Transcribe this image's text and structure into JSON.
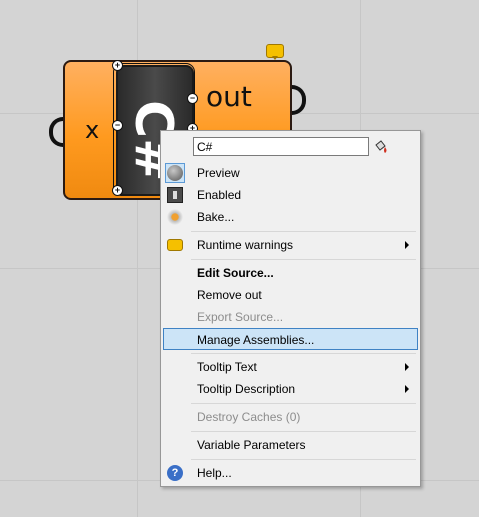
{
  "component": {
    "input_label": "x",
    "output_label": "out",
    "glyph": "C#"
  },
  "menu": {
    "name_value": "C#",
    "items": [
      {
        "label": "Preview",
        "icon": "preview-icon",
        "checked": true
      },
      {
        "label": "Enabled",
        "icon": "enabled-icon"
      },
      {
        "label": "Bake...",
        "icon": "bake-icon"
      },
      {
        "label": "Runtime warnings",
        "icon": "warning-icon",
        "submenu": true
      },
      {
        "label": "Edit Source...",
        "bold": true
      },
      {
        "label": "Remove out"
      },
      {
        "label": "Export Source...",
        "disabled": true
      },
      {
        "label": "Manage Assemblies...",
        "highlighted": true
      },
      {
        "label": "Tooltip Text",
        "submenu": true
      },
      {
        "label": "Tooltip Description",
        "submenu": true
      },
      {
        "label": "Destroy Caches (0)",
        "disabled": true
      },
      {
        "label": "Variable Parameters"
      },
      {
        "label": "Help...",
        "icon": "help-icon"
      }
    ]
  },
  "colors": {
    "component_orange": "#ff9a1f",
    "menu_highlight": "#cce4f7",
    "canvas": "#d4d4d4"
  }
}
